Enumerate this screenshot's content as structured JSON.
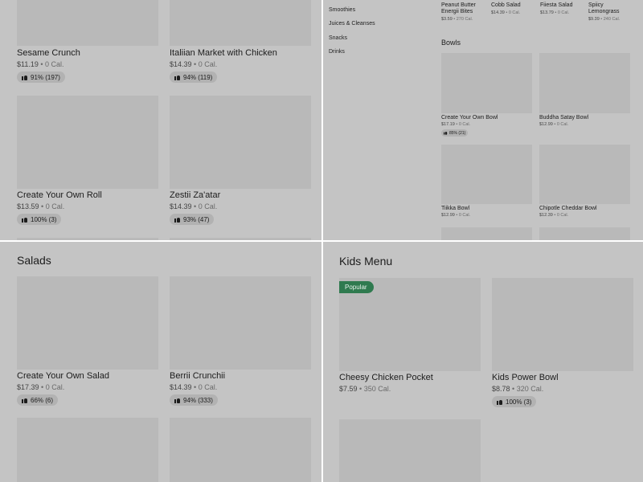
{
  "q1": {
    "items": [
      {
        "name": "Sesame Crunch",
        "price": "$11.19",
        "cal": "0 Cal.",
        "rating": "91% (197)"
      },
      {
        "name": "Italiian Market with Chicken",
        "price": "$14.39",
        "cal": "0 Cal.",
        "rating": "94% (119)"
      },
      {
        "name": "Create Your Own Roll",
        "price": "$13.59",
        "cal": "0 Cal.",
        "rating": "100% (3)"
      },
      {
        "name": "Zestii Za'atar",
        "price": "$14.39",
        "cal": "0 Cal.",
        "rating": "93% (47)"
      }
    ]
  },
  "q2": {
    "sidebar": [
      "Smoothies",
      "Juices & Cleanses",
      "Snacks",
      "Drinks"
    ],
    "top_items": [
      {
        "name": "Peanut Butter Energii Bites",
        "price": "$3.59",
        "cal": "270 Cal."
      },
      {
        "name": "Cobb Salad",
        "price": "$14.39",
        "cal": "0 Cal."
      },
      {
        "name": "Fiiesta Salad",
        "price": "$13.79",
        "cal": "0 Cal."
      },
      {
        "name": "Spiicy Lemongrass",
        "price": "$9.39",
        "cal": "240 Cal."
      }
    ],
    "section": "Bowls",
    "bowls": [
      {
        "name": "Create Your Own Bowl",
        "price": "$17.19",
        "cal": "0 Cal.",
        "rating": "85% (21)"
      },
      {
        "name": "Buddha Satay Bowl",
        "price": "$12.99",
        "cal": "0 Cal."
      },
      {
        "name": "Tiikka Bowl",
        "price": "$12.99",
        "cal": "0 Cal."
      },
      {
        "name": "Chipotle Cheddar Bowl",
        "price": "$12.39",
        "cal": "0 Cal."
      }
    ]
  },
  "q3": {
    "section": "Salads",
    "items": [
      {
        "name": "Create Your Own Salad",
        "price": "$17.39",
        "cal": "0 Cal.",
        "rating": "66% (6)"
      },
      {
        "name": "Berrii Crunchii",
        "price": "$14.39",
        "cal": "0 Cal.",
        "rating": "94% (333)"
      }
    ]
  },
  "q4": {
    "section": "Kids Menu",
    "badge": "Popular",
    "items": [
      {
        "name": "Cheesy Chicken Pocket",
        "price": "$7.59",
        "cal": "350 Cal."
      },
      {
        "name": "Kids Power Bowl",
        "price": "$8.78",
        "cal": "320 Cal.",
        "rating": "100% (3)"
      }
    ]
  },
  "separator": " • ",
  "colors": {
    "background": "#c4c4c4",
    "image_placeholder": "#b9b9b9",
    "popular_badge": "#2f7a4f"
  }
}
